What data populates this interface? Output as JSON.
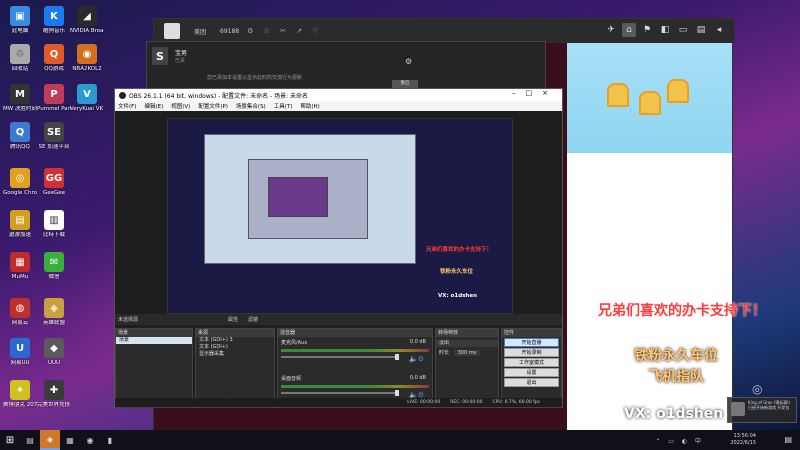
{
  "desktop": {
    "icons": [
      {
        "label": "此电脑",
        "color": "#3a8ae0",
        "glyph": "▣"
      },
      {
        "label": "酷狗音乐",
        "color": "#1a7af0",
        "glyph": "K"
      },
      {
        "label": "NVIDIA Broadcast",
        "color": "#2a2a2a",
        "glyph": "◢"
      },
      {
        "label": "回收站",
        "color": "#aaaaaa",
        "glyph": "♲"
      },
      {
        "label": "QQ游戏",
        "color": "#e05a2a",
        "glyph": "Q"
      },
      {
        "label": "NBA2KOL2",
        "color": "#d07020",
        "glyph": "◉"
      },
      {
        "label": "MW 决胜时刻 现代战争",
        "color": "#333333",
        "glyph": "M"
      },
      {
        "label": "Pummel Party",
        "color": "#c03a5a",
        "glyph": "P"
      },
      {
        "label": "VeryKuai VK 加速器",
        "color": "#2a9ad0",
        "glyph": "V"
      },
      {
        "label": "腾讯QQ",
        "color": "#3a7ad0",
        "glyph": "Q"
      },
      {
        "label": "SE 加速平台",
        "color": "#444444",
        "glyph": "SE"
      },
      {
        "label": "Google Chrome",
        "color": "#e0a020",
        "glyph": "◎"
      },
      {
        "label": "GeeGee",
        "color": "#d03030",
        "glyph": "GG"
      },
      {
        "label": "遨游加速",
        "color": "#d0a020",
        "glyph": "▤"
      },
      {
        "label": "比特下载",
        "color": "#ffffff",
        "glyph": "▥"
      },
      {
        "label": "MuMu",
        "color": "#c02a2a",
        "glyph": "▦"
      },
      {
        "label": "微信",
        "color": "#3ab03a",
        "glyph": "✉"
      },
      {
        "label": "网易云",
        "color": "#c0302a",
        "glyph": "◍"
      },
      {
        "label": "英雄联盟",
        "color": "#c8a040",
        "glyph": "◈"
      },
      {
        "label": "网易UU",
        "color": "#2a6ad0",
        "glyph": "U"
      },
      {
        "label": "UUU",
        "color": "#5a5a5a",
        "glyph": "◆"
      },
      {
        "label": "赛博朋克 2077",
        "color": "#d0c020",
        "glyph": "✦"
      },
      {
        "label": "完美世界竞技平台",
        "color": "#3a3a3a",
        "glyph": "✚"
      }
    ]
  },
  "browser": {
    "room_label": "美团",
    "viewer_count": "69188",
    "tool_icons": "⚙ ☆ ✂ ↗ ♡",
    "nav": [
      "✈",
      "⌂",
      "⚑",
      "◧",
      "▭",
      "▤",
      "◂"
    ]
  },
  "notification": {
    "title": "宝男",
    "subtitle": "已关",
    "line": "您已添加本设置以显示此时的交流行为更新",
    "button": "重启"
  },
  "obs": {
    "title": "OBS 26.1.1 (64 bit, windows) - 配置文件: 未命名 - 场景: 未命名",
    "menu": [
      "文件(F)",
      "编辑(E)",
      "视图(V)",
      "配置文件(P)",
      "场景集合(S)",
      "工具(T)",
      "帮助(H)"
    ],
    "preview_caption_1": "兄弟们喜欢的办卡支持下！",
    "preview_caption_2": "铁粉永久车位",
    "preview_caption_3": "VX: o1dshen",
    "scenebar": {
      "label": "未选择源",
      "props": "属性",
      "filters": "滤镜"
    },
    "scenes": {
      "header": "场景",
      "items": [
        "场景"
      ]
    },
    "sources": {
      "header": "来源",
      "items": [
        "文本 (GDI+) 3",
        "文本 (GDI+)",
        "显示器采集"
      ]
    },
    "mixer": {
      "header": "混音器",
      "tracks": [
        {
          "name": "麦克风/Aux",
          "db": "0.0 dB"
        },
        {
          "name": "桌面音频",
          "db": "0.0 dB"
        }
      ]
    },
    "transitions": {
      "header": "转场特效",
      "type": "淡出",
      "duration_label": "时长",
      "duration": "300 ms"
    },
    "controls": {
      "header": "控件",
      "buttons": [
        "开始直播",
        "开始录制",
        "工作室模式",
        "设置",
        "退出"
      ]
    },
    "status": {
      "live": "LIVE: 00:00:00",
      "rec": "REC: 00:00:00",
      "cpu": "CPU: 0.7%, 60.00 fps"
    }
  },
  "overlay": {
    "line_red": "兄弟们喜欢的办卡支持下！",
    "line_pink_1": "铁粉永久车位",
    "line_pink_2": "飞机指队",
    "vx": "VX: o1dshen"
  },
  "toast": {
    "app": "King of Gros (锦标赛I)",
    "text": "已经开始新游戏 开发包"
  },
  "taskbar": {
    "icons": [
      "▤",
      "◈",
      "▦",
      "◉",
      "▮"
    ],
    "time": "13:56:04",
    "date": "2022/6/15",
    "tray": "⌃ ▭ ◐ 中"
  },
  "colors": {
    "accent": "#3a7bd5",
    "overlay_red": "#ff3b3b",
    "overlay_pink": "#ffcc66"
  }
}
